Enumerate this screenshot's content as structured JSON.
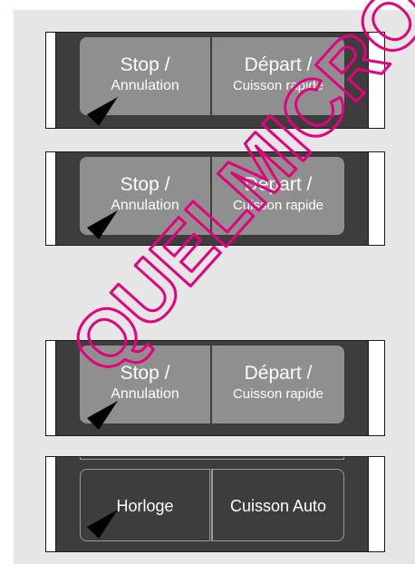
{
  "panels": [
    {
      "left_line1": "Stop /",
      "left_line2": "Annulation",
      "right_line1": "Départ /",
      "right_line2": "Cuisson rapide"
    },
    {
      "left_line1": "Stop /",
      "left_line2": "Annulation",
      "right_line1": "Départ /",
      "right_line2": "Cuisson rapide"
    },
    {
      "left_line1": "Stop /",
      "left_line2": "Annulation",
      "right_line1": "Départ /",
      "right_line2": "Cuisson rapide"
    },
    {
      "left_label": "Horloge",
      "right_label": "Cuisson Auto"
    }
  ],
  "watermark": "QUELMICRO",
  "colors": {
    "background": "#e6e6e6",
    "panel": "#3d3d3d",
    "button": "#8f8f8f",
    "watermark": "#e6007e"
  },
  "icons": [
    "pointer-arrow-icon"
  ]
}
